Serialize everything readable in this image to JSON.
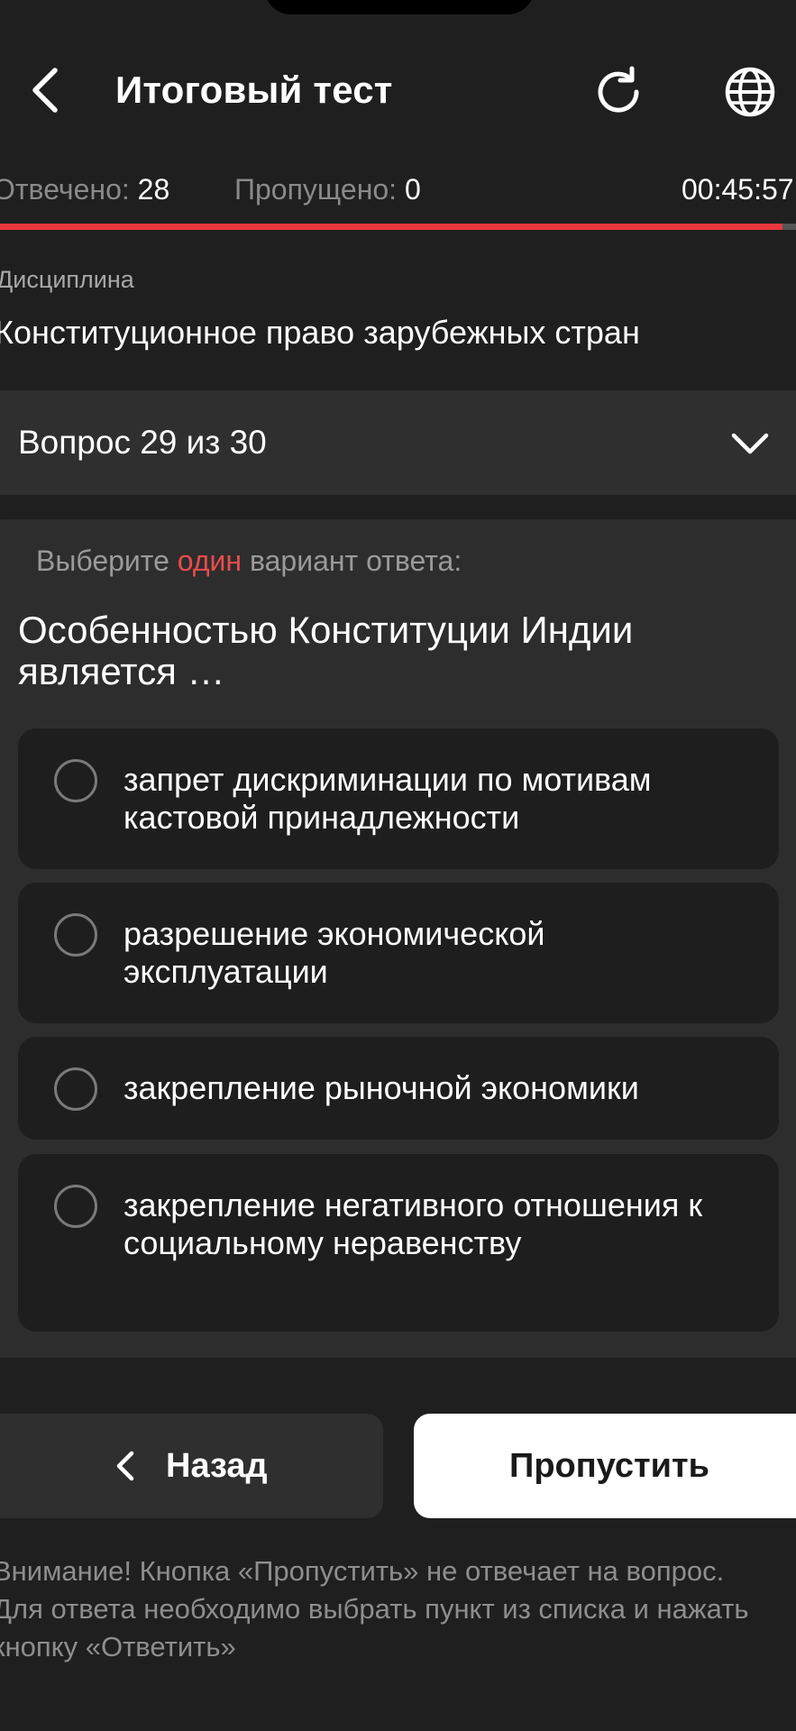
{
  "header": {
    "title": "Итоговый тест",
    "back_icon": "chevron-left-icon",
    "refresh_icon": "refresh-icon",
    "globe_icon": "globe-icon"
  },
  "stats": {
    "answered_label": "Отвечено:",
    "answered_value": "28",
    "skipped_label": "Пропущено:",
    "skipped_value": "0",
    "timer": "00:45:57",
    "progress": 0.983
  },
  "discipline": {
    "label": "Дисциплина",
    "value": "Конституционное право зарубежных стран"
  },
  "question_selector": {
    "label": "Вопрос 29 из 30",
    "icon": "chevron-down-icon"
  },
  "question": {
    "instruction_before": "Выберите ",
    "instruction_accent": "один",
    "instruction_after": " вариант ответа:",
    "text": "Особенностью Конституции Индии является …",
    "options": [
      {
        "text": "запрет дискриминации по мотивам кастовой принадлежности"
      },
      {
        "text": "разрешение экономической эксплуатации"
      },
      {
        "text": "закрепление рыночной экономики"
      },
      {
        "text": "закрепление негативного отношения к социальному неравенству"
      }
    ]
  },
  "footer": {
    "back_label": "Назад",
    "skip_label": "Пропустить",
    "warning": "Внимание! Кнопка «Пропустить» не отвечает на вопрос. Для ответа необходимо выбрать пункт из списка и нажать кнопку «Ответить»"
  },
  "colors": {
    "background": "#1f1f1f",
    "accent": "#e8383d",
    "card": "#2d2d2d",
    "option": "#1e1e1e"
  }
}
